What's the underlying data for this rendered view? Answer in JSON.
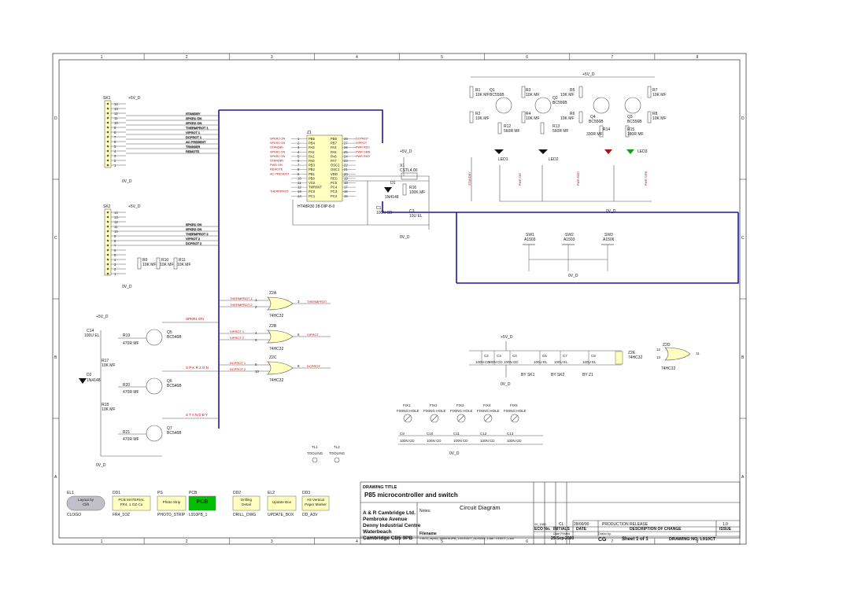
{
  "border": {
    "cols": [
      "1",
      "2",
      "3",
      "4",
      "5",
      "6",
      "7",
      "8"
    ],
    "rows": [
      "D",
      "C",
      "B",
      "A"
    ]
  },
  "title_block": {
    "drawing_title_label": "DRAWING TITLE",
    "drawing_title": "P85 microcontroller and switch",
    "diagram_type": "Circuit Diagram",
    "notes_label": "Notes:",
    "company": "A & R Cambridge Ltd.",
    "address": [
      "Pembroke Avenue",
      "Denny Industrial Centre",
      "Waterbeach",
      "Cambridge CB5 9PB"
    ],
    "release": {
      "eco": "00_1080",
      "initials": "CL",
      "date": "28/09/00",
      "description": "PRODUCTION RELEASE",
      "issue": "1.0"
    },
    "headers": {
      "eco": "ECO No.",
      "initials": "INITIALS",
      "date": "DATE",
      "description": "DESCRIPTION OF CHANGE",
      "issue": "ISSUE"
    },
    "filename_label": "Filename",
    "filename": "J:\\ECO_rep\\00_1080\\L910PB_1.0\\L910CT_1\\L910AY_1.ddb - L910CT_1.sch",
    "date_printed_label": "Date Printed",
    "date_printed": "29-Sep-2000",
    "drawn_by_label": "Drawn by:",
    "drawn_by": "CG",
    "sheet": "Sheet 1 of 1",
    "drawing_no": "DRAWING NO. L910CT"
  },
  "bottom_boxes": [
    {
      "ref": "EL1",
      "text": "Layout by Clift",
      "sub": "CLOGO",
      "color": "#c0c0c8"
    },
    {
      "ref": "DD1",
      "text": "PCB MATERIAL FR4, 1 OZ Cu",
      "sub": "FR4_1OZ",
      "color": "#ffffc0"
    },
    {
      "ref": "PS",
      "text": "Photo Strip",
      "sub": "PHOTO_STRIP",
      "color": "#ffffc0"
    },
    {
      "ref": "PCB",
      "text": "PCB",
      "sub": "L910PB_1",
      "color": "#00c000"
    },
    {
      "ref": "DD2",
      "text": "Drilling Detail",
      "sub": "DRILL_DWG",
      "color": "#ffffc0"
    },
    {
      "ref": "EL2",
      "text": "Update Box",
      "sub": "UPDATE_BOX",
      "color": "#ffffc0"
    },
    {
      "ref": "DD3",
      "text": "A3 Vertical Paper Marker",
      "sub": "DD_A3V",
      "color": "#ffffc0"
    }
  ],
  "connectors": {
    "sk1": {
      "ref": "SK1",
      "pins": [
        "14",
        "13",
        "12",
        "11",
        "10",
        "9",
        "8",
        "7",
        "6",
        "5",
        "4",
        "3",
        "2",
        "1"
      ],
      "nets": [
        "STANDBY",
        "SPKR1 ON",
        "SPKR2 ON",
        "THERMPROT 1",
        "VIPROT 1",
        "DCPROT 1",
        "AC PRESENT",
        "TRIGGER",
        "REMOTE"
      ]
    },
    "sk2": {
      "ref": "SK2",
      "pins": [
        "14",
        "13",
        "12",
        "11",
        "10",
        "9",
        "8",
        "7",
        "6",
        "5",
        "4",
        "3",
        "2",
        "1"
      ],
      "nets": [
        "SPKR1 ON",
        "SPKR2 ON",
        "THERMPROT 2",
        "VIPROT 2",
        "DCPROT 2"
      ]
    },
    "supply": "+5V_D",
    "ground": "0V_D"
  },
  "micro": {
    "ref": "Z1",
    "part": "HT48R30 28-DIP-8-0",
    "left_pins": [
      {
        "n": "1",
        "p": "PB5"
      },
      {
        "n": "2",
        "p": "PB4"
      },
      {
        "n": "3",
        "p": "PA3"
      },
      {
        "n": "4",
        "p": "PA2"
      },
      {
        "n": "5",
        "p": "PA1"
      },
      {
        "n": "6",
        "p": "PA0"
      },
      {
        "n": "7",
        "p": "PB3"
      },
      {
        "n": "8",
        "p": "PB2"
      },
      {
        "n": "9",
        "p": "PB1"
      },
      {
        "n": "10",
        "p": "PB0"
      },
      {
        "n": "11",
        "p": "VSS"
      },
      {
        "n": "12",
        "p": "TMR/INT"
      },
      {
        "n": "13",
        "p": "PC0"
      },
      {
        "n": "14",
        "p": "PC1"
      }
    ],
    "right_pins": [
      {
        "n": "28",
        "p": "PB6"
      },
      {
        "n": "27",
        "p": "PB7"
      },
      {
        "n": "26",
        "p": "PA4"
      },
      {
        "n": "25",
        "p": "PA5"
      },
      {
        "n": "24",
        "p": "PA6"
      },
      {
        "n": "23",
        "p": "PA7"
      },
      {
        "n": "22",
        "p": "OSC2"
      },
      {
        "n": "21",
        "p": "OSC1"
      },
      {
        "n": "20",
        "p": "VDD"
      },
      {
        "n": "19",
        "p": "RES"
      },
      {
        "n": "18",
        "p": "PC5"
      },
      {
        "n": "17",
        "p": "PC4"
      },
      {
        "n": "16",
        "p": "PC3"
      },
      {
        "n": "15",
        "p": "PC2"
      }
    ],
    "left_nets": [
      "SPKR2 ON",
      "SPKR1 ON",
      "STANDBY",
      "SPKR1 ON",
      "SPKR2 ON",
      "STANDBY",
      "PWR ON",
      "REMOTE",
      "AC PRESENT",
      "",
      "",
      "",
      "THERMPROT"
    ],
    "right_nets": [
      "DCPROT",
      "VIPROT",
      "PWR RED",
      "PWR GRN",
      "PWR RED"
    ]
  },
  "components": {
    "xtal": {
      "ref": "X1",
      "val": "CSTL4.00"
    },
    "d1": {
      "ref": "D1",
      "val": "1N4148"
    },
    "r16": {
      "ref": "R16",
      "val": "100K MF"
    },
    "c1": {
      "ref": "C1",
      "val": "100N CD"
    },
    "c3": {
      "ref": "C3",
      "val": "10U EL"
    },
    "r9": {
      "ref": "R9",
      "val": "10K MF"
    },
    "r10": {
      "ref": "R10",
      "val": "10K MF"
    },
    "r11": {
      "ref": "R11",
      "val": "10K MF"
    },
    "c14": {
      "ref": "C14",
      "val": "100U EL"
    },
    "r17": {
      "ref": "R17",
      "val": "10K MF"
    },
    "d2": {
      "ref": "D2",
      "val": "1N4148"
    },
    "r18": {
      "ref": "R18",
      "val": "10K MF"
    },
    "r19": {
      "ref": "R19",
      "val": "470R MF"
    },
    "r20": {
      "ref": "R20",
      "val": "470R MF"
    },
    "r21": {
      "ref": "R21",
      "val": "470R MF"
    },
    "q5": {
      "ref": "Q5",
      "val": "BC546B"
    },
    "q6": {
      "ref": "Q6",
      "val": "BC546B"
    },
    "q7": {
      "ref": "Q7",
      "val": "BC546B"
    },
    "z2a": {
      "ref": "Z2A",
      "val": "74HC32"
    },
    "z2b": {
      "ref": "Z2B",
      "val": "74HC32"
    },
    "z2c": {
      "ref": "Z2C",
      "val": "74HC32"
    },
    "z2d": {
      "ref": "Z2D",
      "val": "74HC32"
    },
    "z2e": {
      "ref": "Z2E",
      "val": "74HC32"
    }
  },
  "gate_nets": {
    "a_in": [
      "THERMPROT 1",
      "THERMPROT 2"
    ],
    "a_out": "THERMPROT",
    "b_in": [
      "VIPROT 1",
      "VIPROT 2"
    ],
    "b_out": "VIPROT",
    "c_in": [
      "DCPROT 1",
      "DCPROT 2"
    ],
    "c_out": "DCPROT",
    "spkr1": "SPKR1 ON",
    "spkr2": "S P K R 2  O N",
    "standby": "S T A N D B Y"
  },
  "led_section": {
    "r1": {
      "ref": "R1",
      "val": "10K MF"
    },
    "r2": {
      "ref": "R2",
      "val": "10K MF"
    },
    "r3": {
      "ref": "R3",
      "val": "10K MF"
    },
    "r4": {
      "ref": "R4",
      "val": "10K MF"
    },
    "r5": {
      "ref": "R5",
      "val": "10K MF"
    },
    "r6": {
      "ref": "R6",
      "val": "10K MF"
    },
    "r7": {
      "ref": "R7",
      "val": "10K MF"
    },
    "r8": {
      "ref": "R8",
      "val": "10K MF"
    },
    "r12": {
      "ref": "R12",
      "val": "560R MF"
    },
    "r13": {
      "ref": "R13",
      "val": "560R MF"
    },
    "r14": {
      "ref": "R14",
      "val": "330R MF"
    },
    "r15": {
      "ref": "R15",
      "val": "180R MF"
    },
    "q1": {
      "ref": "Q1",
      "val": "BC556B"
    },
    "q2": {
      "ref": "Q2",
      "val": "BC556B"
    },
    "q3": {
      "ref": "Q3",
      "val": "BC556B"
    },
    "q4": {
      "ref": "Q4",
      "val": "BC556B"
    },
    "led1": "LED1",
    "led2": "LED2",
    "led3": "LED3",
    "nets": [
      "STANDBY",
      "PWR ON",
      "PWR RED",
      "PWR GRN"
    ]
  },
  "switches": [
    {
      "ref": "SW1",
      "val": "A1503"
    },
    {
      "ref": "SW2",
      "val": "A1503"
    },
    {
      "ref": "SW3",
      "val": "A1506"
    }
  ],
  "decoupling": {
    "caps": [
      {
        "ref": "C2",
        "val": "100N CD"
      },
      {
        "ref": "C3",
        "val": "100N CD"
      },
      {
        "ref": "C4",
        "val": "100N CD"
      },
      {
        "ref": "C6",
        "val": "100U EL"
      },
      {
        "ref": "C7",
        "val": "100U EL"
      },
      {
        "ref": "C8",
        "val": "100U EL"
      }
    ],
    "labels": [
      "BY SK1",
      "BY SK2",
      "BY Z1"
    ]
  },
  "fixing_holes": [
    {
      "ref": "FIX1",
      "val": "FIXING HOLE"
    },
    {
      "ref": "FIX2",
      "val": "FIXING HOLE"
    },
    {
      "ref": "FIX3",
      "val": "FIXING HOLE"
    },
    {
      "ref": "FIX4",
      "val": "FIXING HOLE"
    },
    {
      "ref": "FIX5",
      "val": "FIXING HOLE"
    }
  ],
  "bottom_caps": [
    {
      "ref": "C9",
      "val": "100N CD"
    },
    {
      "ref": "C10",
      "val": "100N CD"
    },
    {
      "ref": "C11",
      "val": "100N CD"
    },
    {
      "ref": "C12",
      "val": "100N CD"
    },
    {
      "ref": "C13",
      "val": "100N CD"
    }
  ],
  "tooling": [
    {
      "ref": "TL1",
      "val": "TOOLING"
    },
    {
      "ref": "TL2",
      "val": "TOOLING"
    }
  ]
}
